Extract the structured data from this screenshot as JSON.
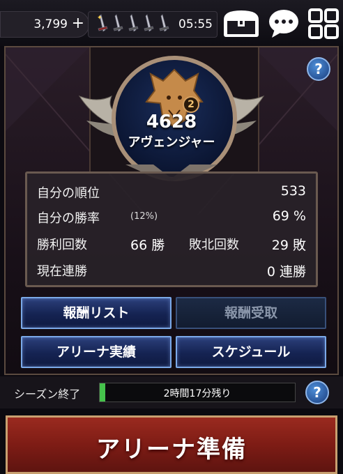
{
  "topbar": {
    "gems": "3,799",
    "gem_add_icon": "plus-icon",
    "stamina_icon": "sword-icon",
    "stamina_count": 5,
    "timer": "05:55"
  },
  "rank": {
    "rating": "4628",
    "title": "アヴェンジャー",
    "tier_badge": "2",
    "emblem_icon": "dragon-emblem-icon"
  },
  "stats": {
    "rank_label": "自分の順位",
    "rank_value": "533",
    "winrate_label": "自分の勝率",
    "winrate_sub": "(12%)",
    "winrate_value": "69 %",
    "wins_label": "勝利回数",
    "wins_value": "66 勝",
    "losses_label": "敗北回数",
    "losses_value": "29 敗",
    "streak_label": "現在連勝",
    "streak_value": "0 連勝"
  },
  "buttons": {
    "reward_list": "報酬リスト",
    "reward_claim": "報酬受取",
    "arena_record": "アリーナ実績",
    "schedule": "スケジュール"
  },
  "season": {
    "label": "シーズン終了",
    "remaining": "2時間17分残り",
    "progress": 0.01
  },
  "ready_button": "アリーナ準備",
  "colors": {
    "accent_blue": "#2b3f7a",
    "ready_red": "#9a2a1f",
    "progress_green": "#45c24b",
    "frame_gold": "#a99078"
  }
}
